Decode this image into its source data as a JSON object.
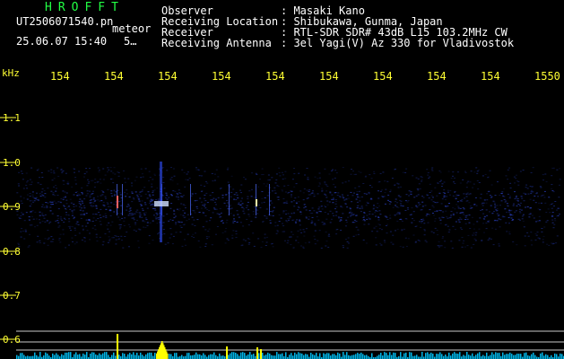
{
  "header": {
    "logo": "HROFFT",
    "filename": "UT2506071540.pn",
    "mode": "meteor",
    "date_time": "25.06.07 15:40",
    "number": "5…"
  },
  "info": {
    "observer_label": "Observer",
    "observer_value": ": Masaki Kano",
    "location_label": "Receiving Location",
    "location_value": ": Shibukawa, Gunma, Japan",
    "receiver_label": "Receiver",
    "receiver_value": ": RTL-SDR SDR# 43dB L15 103.2MHz CW",
    "antenna_label": "Receiving Antenna",
    "antenna_value": ": 3el Yagi(V) Az 330 for Vladivostok"
  },
  "axis": {
    "unit": "kHz",
    "time_ticks": [
      "154",
      "154",
      "154",
      "154",
      "154",
      "154",
      "154",
      "154",
      "154",
      "1550"
    ],
    "freq_ticks": [
      "1.1",
      "1.0",
      "0.9",
      "0.8",
      "0.7",
      "0.6"
    ]
  },
  "colors": {
    "background": "#000000",
    "text": "#ffffff",
    "logo": "#22ff44",
    "axis": "#ffff33",
    "noise": "#1a2a80",
    "signal": "#ffff00",
    "baseline": "#00c8ff"
  }
}
